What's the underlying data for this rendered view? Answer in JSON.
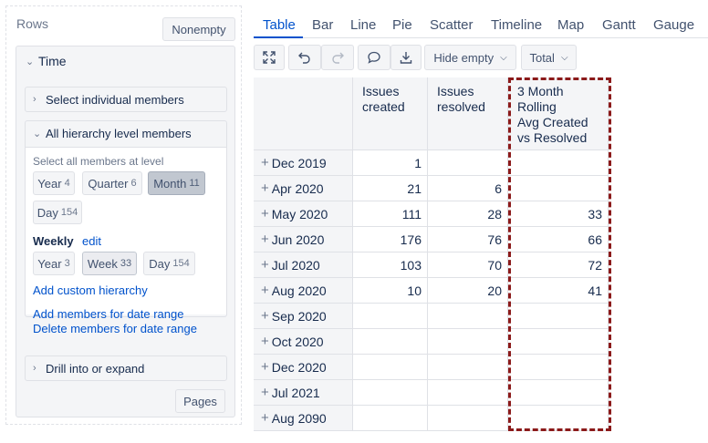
{
  "rows_panel": {
    "title": "Rows",
    "nonempty_label": "Nonempty",
    "pages_label": "Pages"
  },
  "time_dimension": {
    "title": "Time",
    "select_individual_label": "Select individual members",
    "all_levels": {
      "title": "All hierarchy level members",
      "hint": "Select all members at level",
      "levels": [
        {
          "name": "Year",
          "count": "4"
        },
        {
          "name": "Quarter",
          "count": "6"
        },
        {
          "name": "Month",
          "count": "11",
          "selected": true
        },
        {
          "name": "Day",
          "count": "154"
        }
      ],
      "weekly_label": "Weekly",
      "edit_label": "edit",
      "weekly_levels": [
        {
          "name": "Year",
          "count": "3"
        },
        {
          "name": "Week",
          "count": "33",
          "selected": true
        },
        {
          "name": "Day",
          "count": "154"
        }
      ],
      "add_custom_hierarchy": "Add custom hierarchy",
      "add_members_date_range": "Add members for date range",
      "delete_members_date_range": "Delete members for date range"
    },
    "drill_label": "Drill into or expand"
  },
  "tabs": [
    "Table",
    "Bar",
    "Line",
    "Pie",
    "Scatter",
    "Timeline",
    "Map",
    "Gantt",
    "Gauge"
  ],
  "active_tab": "Table",
  "toolbar": {
    "icons": [
      "fullscreen-icon",
      "undo-icon",
      "redo-icon",
      "comment-icon",
      "download-icon"
    ],
    "hide_empty_label": "Hide empty",
    "total_label": "Total"
  },
  "table": {
    "headers": [
      "Issues created",
      "Issues resolved",
      "3 Month Rolling Avg Created vs Resolved"
    ],
    "header_lines": [
      [
        "Issues",
        "created"
      ],
      [
        "Issues",
        "resolved"
      ],
      [
        "3 Month",
        "Rolling",
        "Avg Created",
        "vs Resolved"
      ]
    ],
    "rows": [
      {
        "label": "Dec 2019",
        "values": [
          "1",
          "",
          ""
        ]
      },
      {
        "label": "Apr 2020",
        "values": [
          "21",
          "6",
          ""
        ]
      },
      {
        "label": "May 2020",
        "values": [
          "111",
          "28",
          "33"
        ]
      },
      {
        "label": "Jun 2020",
        "values": [
          "176",
          "76",
          "66"
        ]
      },
      {
        "label": "Jul 2020",
        "values": [
          "103",
          "70",
          "72"
        ]
      },
      {
        "label": "Aug 2020",
        "values": [
          "10",
          "20",
          "41"
        ]
      },
      {
        "label": "Sep 2020",
        "values": [
          "",
          "",
          ""
        ]
      },
      {
        "label": "Oct 2020",
        "values": [
          "",
          "",
          ""
        ]
      },
      {
        "label": "Dec 2020",
        "values": [
          "",
          "",
          ""
        ]
      },
      {
        "label": "Jul 2021",
        "values": [
          "",
          "",
          ""
        ]
      },
      {
        "label": "Aug 2090",
        "values": [
          "",
          "",
          ""
        ]
      }
    ]
  },
  "colors": {
    "accent": "#0052cc",
    "highlight": "#8b1a1a",
    "selected_button": "#c1c7d0"
  }
}
